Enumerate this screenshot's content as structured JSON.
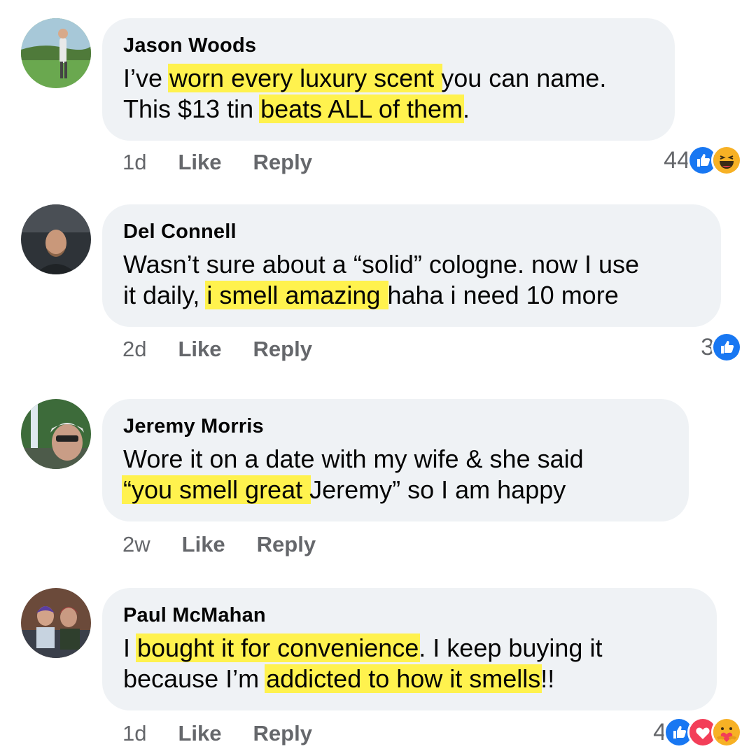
{
  "comments": [
    {
      "name": "Jason Woods",
      "line1": {
        "a": "I’ve ",
        "b": "worn every luxury scent ",
        "c": "you can name."
      },
      "line2": {
        "a": "This $13 tin ",
        "b": "beats ALL of them",
        "c": "."
      },
      "time": "1d",
      "like": "Like",
      "reply": "Reply",
      "reaction_count": "44",
      "reactions": [
        "like-icon",
        "haha-icon"
      ]
    },
    {
      "name": "Del Connell",
      "line1": {
        "a": "Wasn’t sure about a “solid” cologne. now I use",
        "b": "",
        "c": ""
      },
      "line2": {
        "a": "it daily, ",
        "b": "i smell amazing ",
        "c": "haha i need 10 more"
      },
      "time": "2d",
      "like": "Like",
      "reply": "Reply",
      "reaction_count": "3",
      "reactions": [
        "like-icon"
      ]
    },
    {
      "name": "Jeremy Morris",
      "line1": {
        "a": "Wore it on a date with my wife & she said",
        "b": "",
        "c": ""
      },
      "line2": {
        "a": "",
        "b": "“you smell great ",
        "c": "Jeremy” so I am happy"
      },
      "time": "2w",
      "like": "Like",
      "reply": "Reply",
      "reaction_count": "",
      "reactions": []
    },
    {
      "name": "Paul McMahan",
      "line1": {
        "a": "I ",
        "b": "bought it for convenience",
        "c": ". I keep buying it"
      },
      "line2": {
        "a": "because I’m ",
        "b": "addicted to how it smells",
        "c": "!!"
      },
      "time": "1d",
      "like": "Like",
      "reply": "Reply",
      "reaction_count": "4",
      "reactions": [
        "like-icon",
        "love-icon",
        "care-icon"
      ]
    }
  ],
  "colors": {
    "bubble": "#eff2f5",
    "highlight": "#fff24e",
    "meta": "#65676b",
    "like_blue": "#1877f2",
    "love_red": "#f33e58",
    "haha_yellow": "#f7b125"
  }
}
